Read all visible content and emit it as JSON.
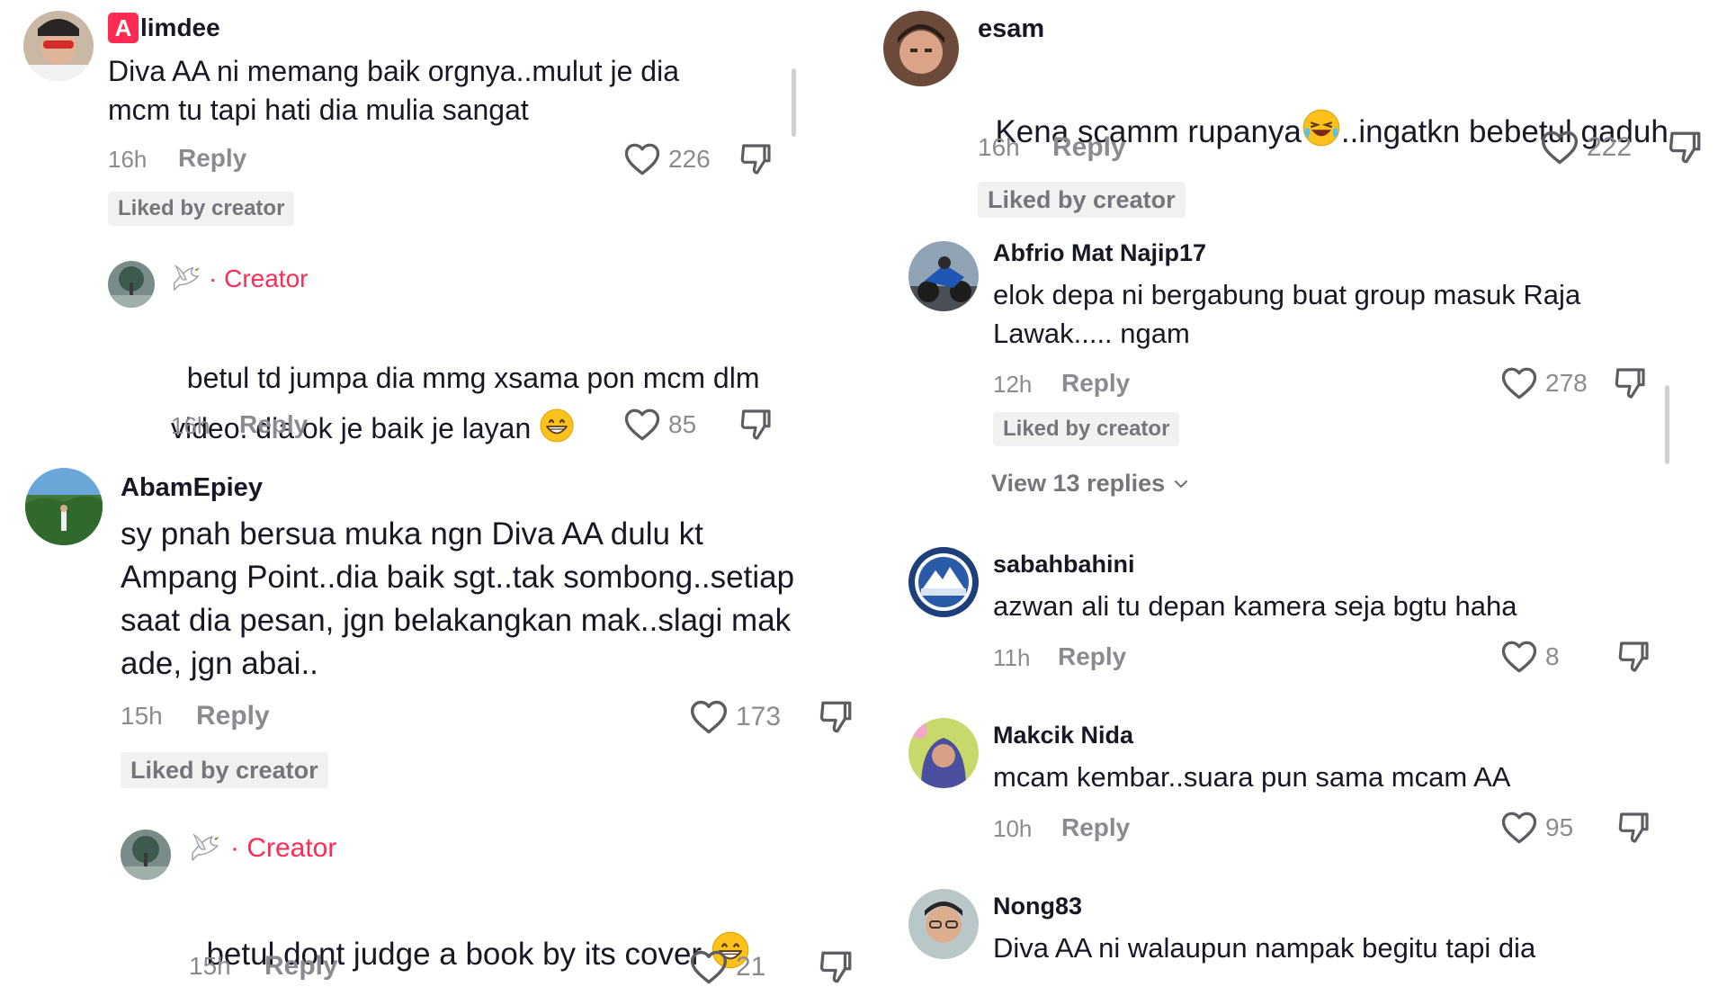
{
  "left": {
    "c1": {
      "user_badge": "A",
      "username": "limdee",
      "text": "Diva AA ni memang baik orgnya..mulut je dia\nmcm tu tapi hati dia mulia sangat",
      "time": "16h",
      "reply": "Reply",
      "likes": "226",
      "badge": "Liked by creator"
    },
    "r1": {
      "creator_label": "· Creator",
      "text_line1": "betul td jumpa dia mmg xsama pon mcm dlm",
      "text_line2": "video. dia ok je baik je layan",
      "time": "16h",
      "reply": "Reply",
      "likes": "85"
    },
    "c2": {
      "username": "AbamEpiey",
      "text": "sy pnah bersua muka ngn Diva AA dulu kt\nAmpang Point..dia baik sgt..tak sombong..setiap\nsaat dia pesan, jgn belakangkan mak..slagi mak\nade, jgn abai..",
      "time": "15h",
      "reply": "Reply",
      "likes": "173",
      "badge": "Liked by creator"
    },
    "r2": {
      "creator_label": "· Creator",
      "text": "betul dont judge a book by its cover",
      "time": "15h",
      "reply": "Reply",
      "likes": "21"
    }
  },
  "right": {
    "c1": {
      "username": "esam",
      "text_before": "Kena scamm rupanya",
      "text_after": "..ingatkn bebetul gaduh",
      "time": "16h",
      "reply": "Reply",
      "likes": "222",
      "badge": "Liked by creator"
    },
    "c2": {
      "username": "Abfrio Mat Najip17",
      "text": "elok depa ni bergabung buat group masuk Raja\nLawak..... ngam",
      "time": "12h",
      "reply": "Reply",
      "likes": "278",
      "badge": "Liked by creator",
      "view_replies": "View 13 replies"
    },
    "c3": {
      "username": "sabahbahini",
      "text": "azwan ali tu depan kamera seja bgtu haha",
      "time": "11h",
      "reply": "Reply",
      "likes": "8"
    },
    "c4": {
      "username": "Makcik Nida",
      "text": "mcam kembar..suara pun sama mcam AA",
      "time": "10h",
      "reply": "Reply",
      "likes": "95"
    },
    "c5": {
      "username": "Nong83",
      "text": "Diva AA ni walaupun nampak begitu tapi dia"
    }
  },
  "colors": {
    "creator_red": "#fe2c55",
    "muted_gray": "#8a8b91",
    "badge_bg": "#f1f1f2",
    "text": "#161823"
  },
  "icons": [
    "heart-outline-icon",
    "thumbs-down-icon",
    "dove-icon",
    "chevron-down-icon",
    "laughing-emoji-icon",
    "grinning-emoji-icon"
  ]
}
